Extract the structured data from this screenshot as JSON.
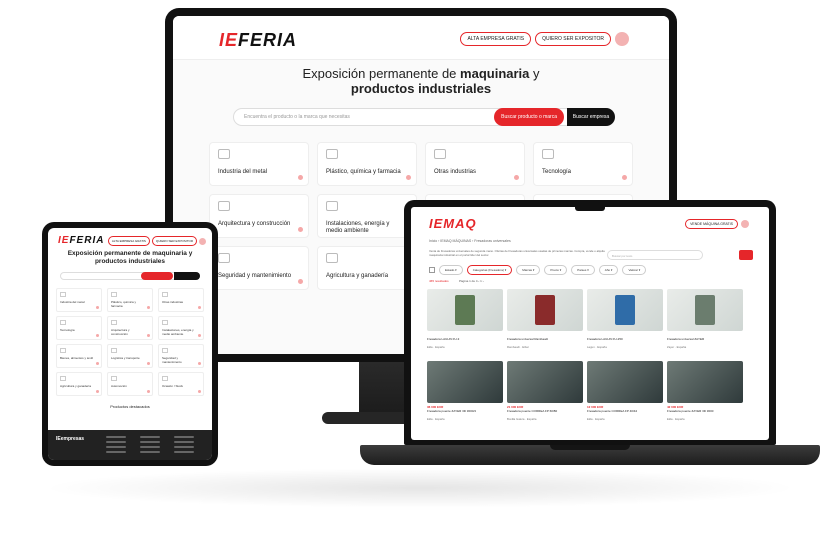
{
  "desktop": {
    "logo_a": "IE",
    "logo_b": "FERIA",
    "header_btn_1": "ALTA EMPRESA GRATIS",
    "header_btn_2": "QUIERO SER EXPOSITOR",
    "title_line1_pre": "Exposición permanente de ",
    "title_line1_bold": "maquinaria",
    "title_line1_post": " y",
    "title_line2": "productos industriales",
    "search_placeholder": "Encuentra el producto o la marca que necesitas",
    "search_btn_products": "Buscar producto o marca",
    "search_btn_companies": "Buscar empresa",
    "categories": [
      "Industria del metal",
      "Plástico, química y farmacia",
      "Otras industrias",
      "Tecnología",
      "Arquitectura y construcción",
      "Instalaciones, energía y medio ambiente",
      "",
      "",
      "Seguridad y mantenimiento",
      "Agricultura y ganadería",
      "",
      ""
    ]
  },
  "tablet": {
    "logo_a": "IE",
    "logo_b": "FERIA",
    "title_line1": "Exposición permanente de maquinaria y",
    "title_line2": "productos industriales",
    "categories": [
      "Industria del metal",
      "Plástico, química y farmacia",
      "Otras industrias",
      "Tecnología",
      "Arquitectura y construcción",
      "Instalaciones, energía y medio ambiente",
      "Bienes, alimentos y textil",
      "Logística y transporte",
      "Seguridad y mantenimiento",
      "Agricultura y ganadería",
      "Automoción",
      "Ocasión / Stock"
    ],
    "featured": "Productos destacados",
    "footer_logo": "IEempresas"
  },
  "laptop": {
    "logo_a": "IE",
    "logo_b": "MAQ",
    "header_btn": "VENDE MÁQUINA GRATIS",
    "breadcrumb": "Inicio  ›  IEMAQ MÁQUINAS  ›  Fresadoras universales",
    "description": "Venta de Fresadoras universales de segunda mano. Ofertas de Fresadoras universales usadas de primeras marcas. Compra, vende o alquila maquinaria industrial en el portal líder del sector.",
    "search_placeholder": "Buscar por texto",
    "filters": [
      "Estado ▾",
      "Categorías (Fresadora) ▾",
      "Marcas ▾",
      "Precio ▾",
      "Países ▾",
      "Año ▾",
      "Valorar ▾"
    ],
    "count": "465 resultados",
    "pager": "Página 1 de 4   ‹  1  ›",
    "products": [
      {
        "price": "",
        "name": "Fresadora LAGUN FU-3",
        "loc": "Elda · España",
        "dark": false
      },
      {
        "price": "",
        "name": "Fresadora universal Rambaudi",
        "loc": "Rambaudi · Eibar",
        "dark": false
      },
      {
        "price": "",
        "name": "Fresadora LAGUN FU-250",
        "loc": "Lagun · España",
        "dark": false
      },
      {
        "price": "",
        "name": "Fresadora universal ZAYER",
        "loc": "Zayer · España",
        "dark": false
      },
      {
        "price": "36 000 EUR",
        "name": "Fresadora puente ZAYER 3D 3000/4",
        "loc": "Elda · España",
        "dark": true
      },
      {
        "price": "21 000 EUR",
        "name": "Fresadora puente CORREA FP 60/80",
        "loc": "Bovilla Galera · España",
        "dark": true
      },
      {
        "price": "12 000 EUR",
        "name": "Fresadora puente CORREA FP 40/42",
        "loc": "Elda · España",
        "dark": true
      },
      {
        "price": "42 000 EUR",
        "name": "Fresadora puente ZAYER 3D 3000",
        "loc": "Elda · España",
        "dark": true
      }
    ]
  },
  "colors": {
    "accent": "#e5262a",
    "dark": "#111111"
  }
}
